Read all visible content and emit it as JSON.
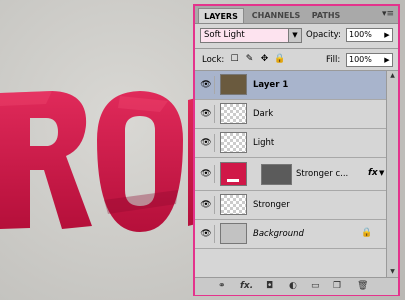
{
  "canvas": {
    "letters": "RO"
  },
  "tabs": [
    {
      "label": "LAYERS"
    },
    {
      "label": "CHANNELS"
    },
    {
      "label": "PATHS"
    }
  ],
  "blend_mode": "Soft Light",
  "opacity": {
    "label": "Opacity:",
    "value": "100%"
  },
  "lock": {
    "label": "Lock:"
  },
  "fill": {
    "label": "Fill:",
    "value": "100%"
  },
  "layers": [
    {
      "name": "Layer 1",
      "selected": true
    },
    {
      "name": "Dark"
    },
    {
      "name": "Light"
    },
    {
      "name": "Stronger c...",
      "fx": "fx"
    },
    {
      "name": "Stronger"
    },
    {
      "name": "Background"
    }
  ],
  "colors": {
    "panel_border": "#e4338c",
    "text_red": "#cc1744",
    "selected_row": "#a8b4cc"
  }
}
